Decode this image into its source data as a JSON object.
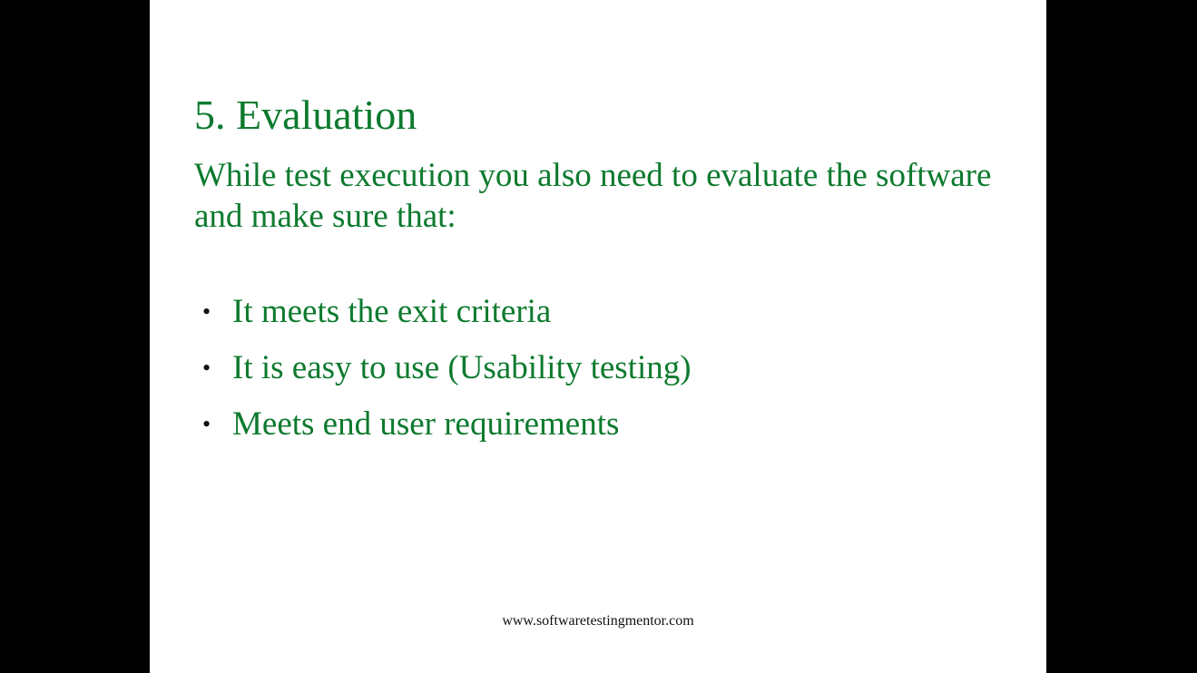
{
  "slide": {
    "title": "5. Evaluation",
    "intro": "While test execution you also need to evaluate the software and make sure that:",
    "bullets": [
      "It meets the exit criteria",
      "It is easy to use (Usability testing)",
      "Meets end user requirements"
    ],
    "bullet_glyph": "•",
    "footer": "www.softwaretestingmentor.com"
  },
  "colors": {
    "text_green": "#0d7a2e",
    "background": "#ffffff",
    "letterbox": "#000000"
  }
}
